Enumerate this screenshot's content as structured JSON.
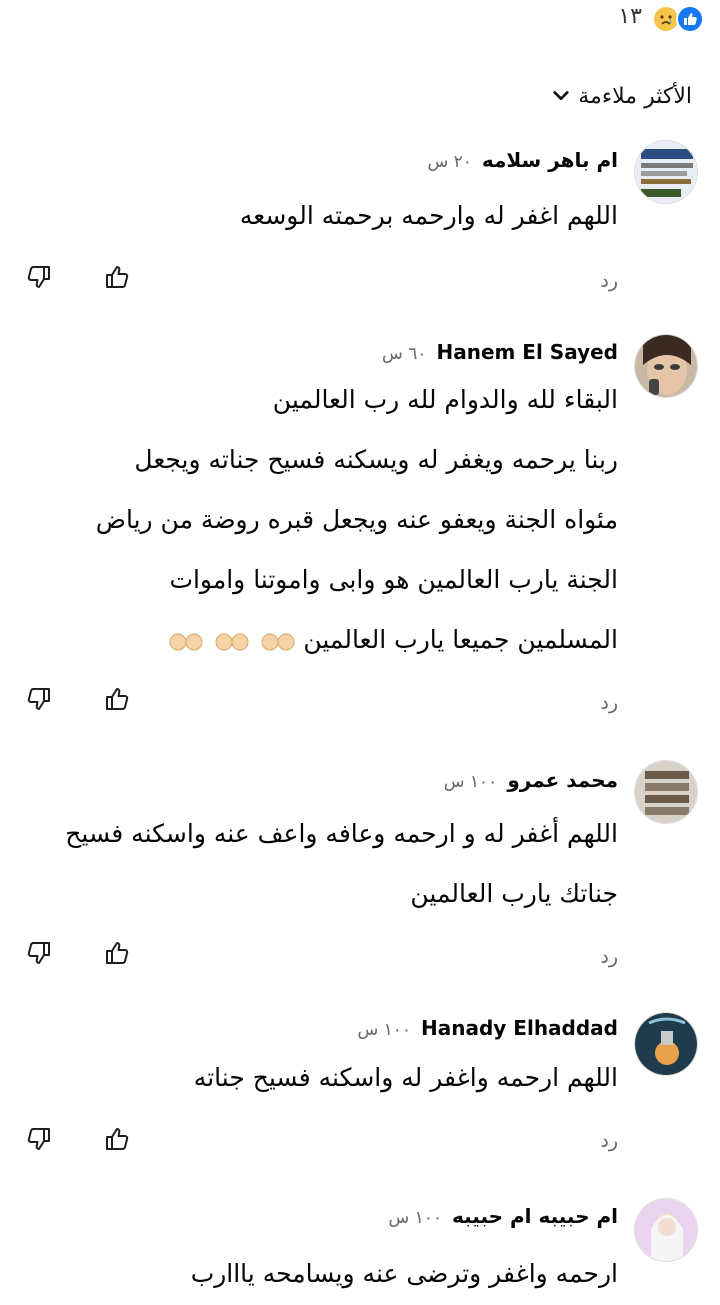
{
  "reactions": {
    "count": "١٣",
    "icons": [
      "like-icon",
      "sad-icon"
    ]
  },
  "sort": {
    "label": "الأكثر ملاءمة"
  },
  "reply_label": "رد",
  "comments": [
    {
      "author": "ام باهر سلامه",
      "time": "٢٠ س",
      "lines": [
        "اللهم اغفر له وارحمه برحمته الوسعه"
      ]
    },
    {
      "author": "Hanem El Sayed",
      "time": "٦٠ س",
      "lines": [
        "البقاء لله والدوام لله رب العالمين",
        "ربنا يرحمه ويغفر له ويسكنه فسيح جناته ويجعل",
        "مئواه الجنة ويعفو عنه ويجعل قبره روضة من رياض",
        "الجنة يارب العالمين هو وابى واموتنا واموات",
        "المسلمين جميعا يارب العالمين"
      ],
      "emoji": "palms-up-together-icon"
    },
    {
      "author": "محمد عمرو",
      "time": "١٠٠ س",
      "lines": [
        "اللهم أغفر له و ارحمه وعافه واعف عنه واسكنه فسيح",
        "جناتك يارب العالمين"
      ]
    },
    {
      "author": "Hanady Elhaddad",
      "time": "١٠٠ س",
      "lines": [
        "اللهم ارحمه واغفر له واسكنه فسيح جناته"
      ]
    },
    {
      "author": "ام حبيبه ام حبيبه",
      "time": "١٠٠ س",
      "lines": [
        "ارحمه واغفر وترضى عنه ويسامحه يااارب"
      ]
    }
  ]
}
